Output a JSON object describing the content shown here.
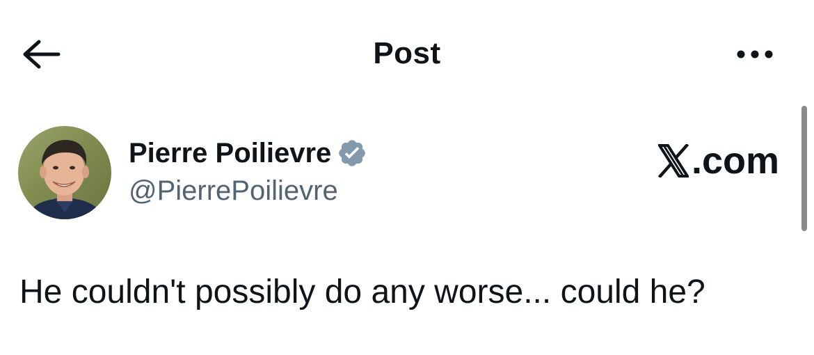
{
  "header": {
    "title": "Post",
    "back_icon": "arrow-left-icon",
    "more_icon": "more-horizontal-icon"
  },
  "author": {
    "name": "Pierre Poilievre",
    "handle": "@PierrePoilievre",
    "verified": true,
    "badge_color": "#829aab"
  },
  "watermark": {
    "text": ".com"
  },
  "post": {
    "text": "He couldn't possibly do any worse... could he?"
  },
  "colors": {
    "text_primary": "#0f1419",
    "text_secondary": "#536471",
    "background": "#ffffff"
  }
}
